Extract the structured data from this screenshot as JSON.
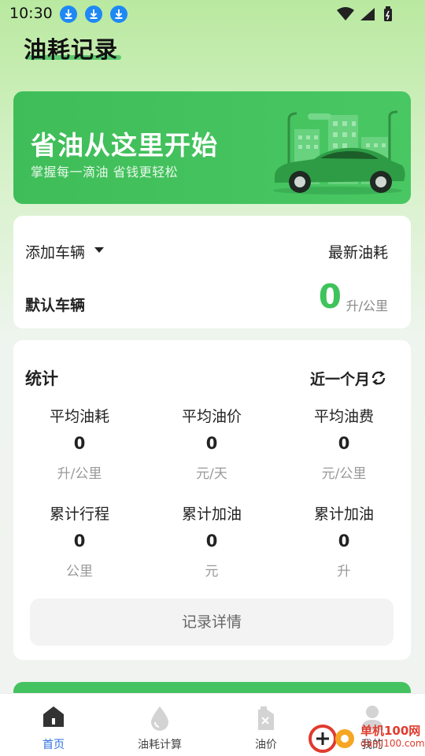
{
  "status_bar": {
    "time": "10:30",
    "icons": [
      "download-icon",
      "download-icon",
      "download-icon",
      "wifi-icon",
      "signal-icon",
      "battery-icon"
    ]
  },
  "header": {
    "title": "油耗记录"
  },
  "banner": {
    "title": "省油从这里开始",
    "subtitle": "掌握每一滴油 省钱更轻松"
  },
  "vehicle": {
    "add_label": "添加车辆",
    "latest_label": "最新油耗",
    "default_vehicle": "默认车辆",
    "latest_value": "0",
    "latest_unit": "升/公里"
  },
  "stats": {
    "title": "统计",
    "period": "近一个月",
    "items": [
      {
        "label": "平均油耗",
        "value": "0",
        "unit": "升/公里"
      },
      {
        "label": "平均油价",
        "value": "0",
        "unit": "元/天"
      },
      {
        "label": "平均油费",
        "value": "0",
        "unit": "元/公里"
      },
      {
        "label": "累计行程",
        "value": "0",
        "unit": "公里"
      },
      {
        "label": "累计加油",
        "value": "0",
        "unit": "元"
      },
      {
        "label": "累计加油",
        "value": "0",
        "unit": "升"
      }
    ],
    "detail_button": "记录详情"
  },
  "bottom_nav": {
    "items": [
      {
        "label": "首页",
        "icon": "home-icon",
        "active": true
      },
      {
        "label": "油耗计算",
        "icon": "droplet-icon",
        "active": false
      },
      {
        "label": "油价",
        "icon": "fuel-can-icon",
        "active": false
      },
      {
        "label": "我的",
        "icon": "person-icon",
        "active": false
      }
    ]
  },
  "watermark": {
    "text": "单机100网",
    "url": "danji100.com"
  },
  "colors": {
    "accent": "#3fc35b",
    "banner": "#43c25f",
    "active_nav": "#2f6fe0",
    "download_badge": "#1e88f5"
  }
}
